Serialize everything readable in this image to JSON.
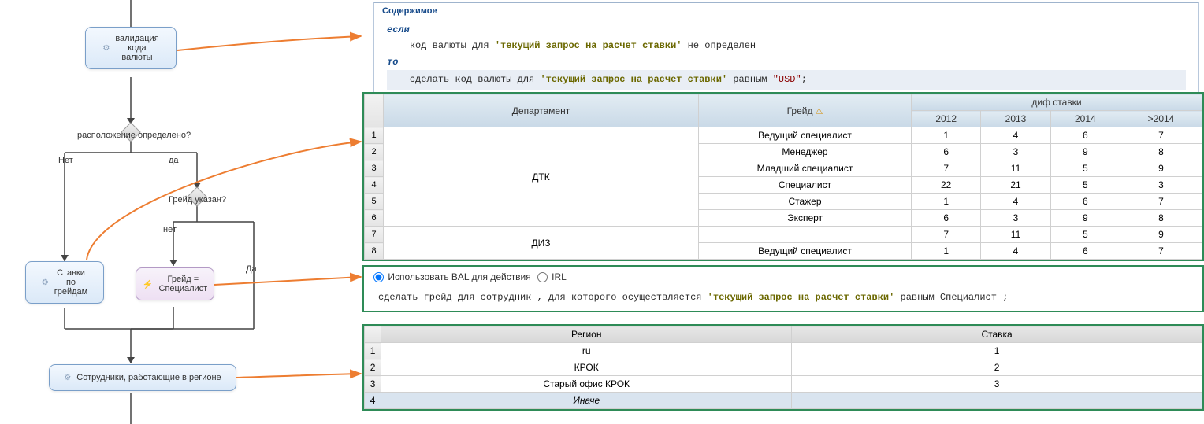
{
  "flowchart": {
    "validate_node": "валидация\nкода\nвалюты",
    "decision1": "расположение определено?",
    "branch_no": "Нет",
    "branch_yes": "да",
    "decision2": "Грейд указан?",
    "branch2_no": "нет",
    "branch2_yes": "Да",
    "rates_node": "Ставки\nпо\nгрейдам",
    "grade_node": "Грейд =\nСпециалист",
    "region_node": "Сотрудники, работающие в регионе"
  },
  "code_panel": {
    "header": "Содержимое",
    "if_kw": "если",
    "line1_a": "код валюты для ",
    "line1_q": "'текущий запрос на расчет ставки'",
    "line1_b": " не определен",
    "then_kw": "то",
    "line2_a": "сделать код валюты для ",
    "line2_q": "'текущий запрос на расчет ставки'",
    "line2_b": " равным ",
    "line2_lit": "\"USD\"",
    "line2_end": ";"
  },
  "dept_table": {
    "col_dept": "Департамент",
    "col_grade": "Грейд",
    "col_diff": "диф ставки",
    "years": [
      "2012",
      "2013",
      "2014",
      ">2014"
    ],
    "group_dtk": "ДТК",
    "group_diz": "ДИЗ",
    "rows": [
      {
        "n": "1",
        "grade": "Ведущий специалист",
        "vals": [
          "1",
          "4",
          "6",
          "7"
        ]
      },
      {
        "n": "2",
        "grade": "Менеджер",
        "vals": [
          "6",
          "3",
          "9",
          "8"
        ]
      },
      {
        "n": "3",
        "grade": "Младший специалист",
        "vals": [
          "7",
          "11",
          "5",
          "9"
        ]
      },
      {
        "n": "4",
        "grade": "Специалист",
        "vals": [
          "22",
          "21",
          "5",
          "3"
        ]
      },
      {
        "n": "5",
        "grade": "Стажер",
        "vals": [
          "1",
          "4",
          "6",
          "7"
        ]
      },
      {
        "n": "6",
        "grade": "Эксперт",
        "vals": [
          "6",
          "3",
          "9",
          "8"
        ]
      },
      {
        "n": "7",
        "grade": "",
        "vals": [
          "7",
          "11",
          "5",
          "9"
        ]
      },
      {
        "n": "8",
        "grade": "Ведущий специалист",
        "vals": [
          "1",
          "4",
          "6",
          "7"
        ]
      }
    ]
  },
  "radios": {
    "opt_bal": "Использовать BAL для действия",
    "opt_irl": "IRL"
  },
  "rule_text": {
    "a": "сделать грейд для сотрудник , для которого осуществляется ",
    "q": "'текущий запрос на расчет ставки'",
    "b": " равным Специалист ;"
  },
  "region_table": {
    "col_region": "Регион",
    "col_rate": "Ставка",
    "rows": [
      {
        "n": "1",
        "region": "ru",
        "rate": "1"
      },
      {
        "n": "2",
        "region": "КРОК",
        "rate": "2"
      },
      {
        "n": "3",
        "region": "Старый офис КРОК",
        "rate": "3"
      },
      {
        "n": "4",
        "region": "Иначе",
        "rate": ""
      }
    ]
  }
}
